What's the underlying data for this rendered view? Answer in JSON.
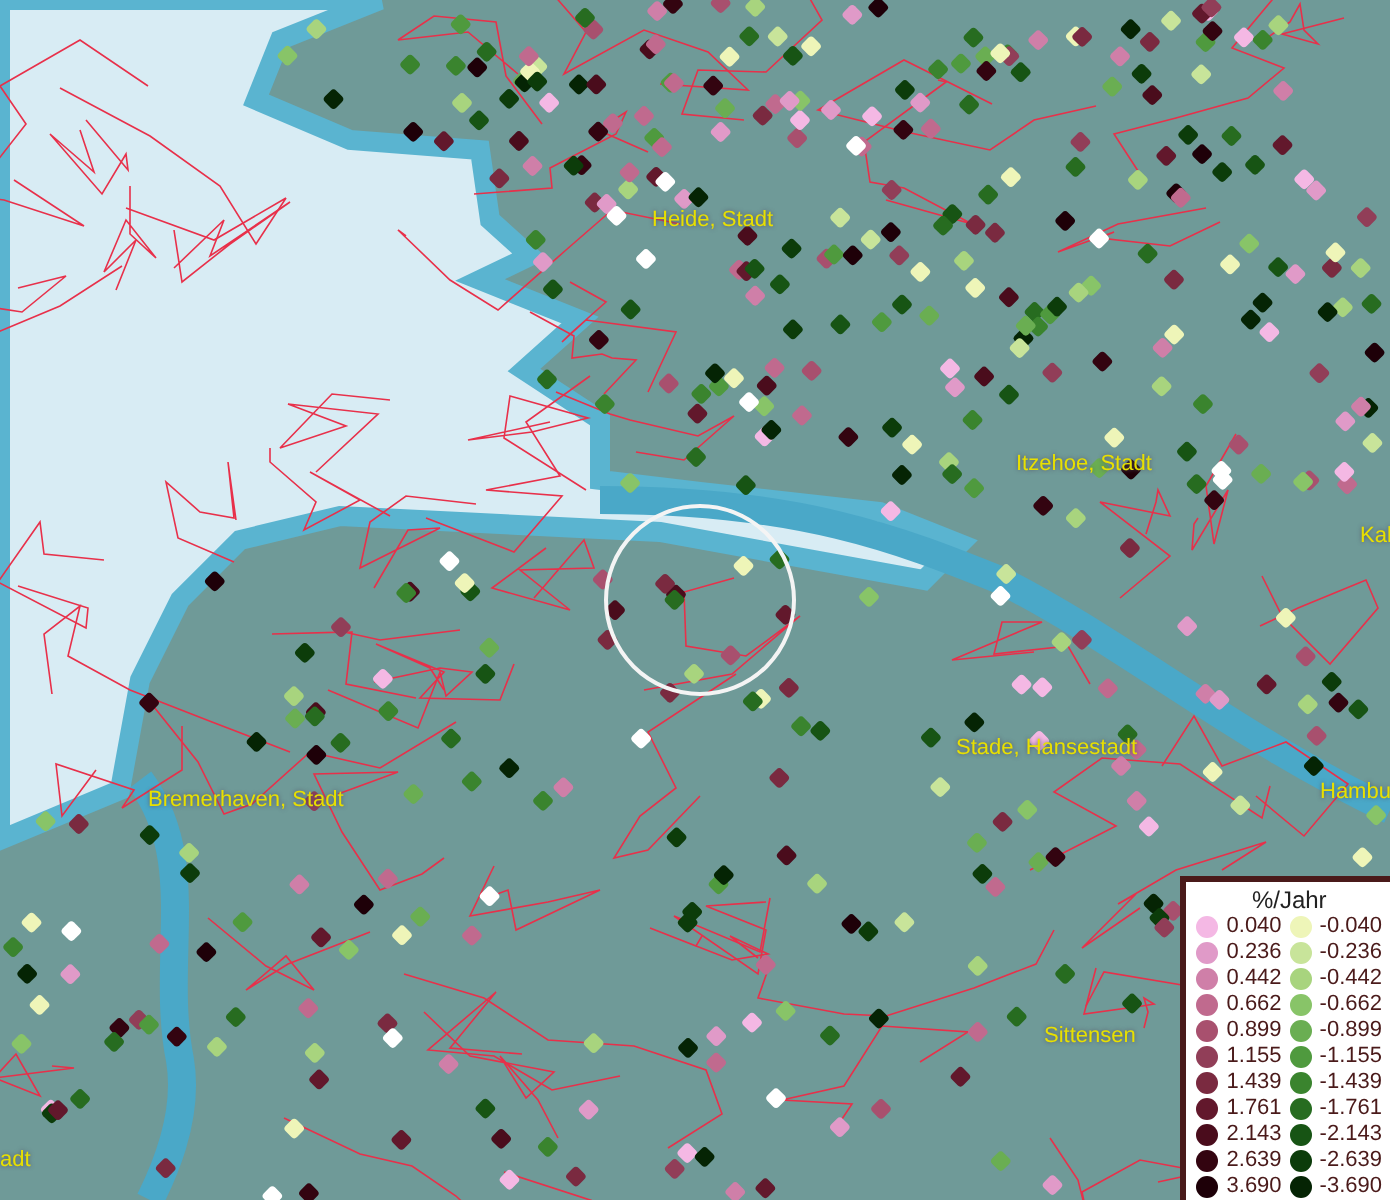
{
  "map": {
    "places": [
      {
        "name": "Heide, Stadt"
      },
      {
        "name": "Itzehoe, Stadt"
      },
      {
        "name": "Kal"
      },
      {
        "name": "Stade, Hansestadt"
      },
      {
        "name": "Hambu"
      },
      {
        "name": "Bremerhaven, Stadt"
      },
      {
        "name": "Sittensen"
      },
      {
        "name": "adt"
      }
    ]
  },
  "legend": {
    "title": "%/Jahr",
    "increase": [
      {
        "value": "0.040",
        "color": "#f4b8e4"
      },
      {
        "value": "0.236",
        "color": "#e09ac8"
      },
      {
        "value": "0.442",
        "color": "#cf7fa8"
      },
      {
        "value": "0.662",
        "color": "#c06a8e"
      },
      {
        "value": "0.899",
        "color": "#a8506e"
      },
      {
        "value": "1.155",
        "color": "#913e58"
      },
      {
        "value": "1.439",
        "color": "#7a2a40"
      },
      {
        "value": "1.761",
        "color": "#62182c"
      },
      {
        "value": "2.143",
        "color": "#4a0c1c"
      },
      {
        "value": "2.639",
        "color": "#330410"
      },
      {
        "value": "3.690",
        "color": "#1e0008"
      }
    ],
    "decrease": [
      {
        "value": "-0.040",
        "color": "#eef5b8"
      },
      {
        "value": "-0.236",
        "color": "#c8e49a"
      },
      {
        "value": "-0.442",
        "color": "#a8d47e"
      },
      {
        "value": "-0.662",
        "color": "#88c468"
      },
      {
        "value": "-0.899",
        "color": "#6aae52"
      },
      {
        "value": "-1.155",
        "color": "#4f9a3e"
      },
      {
        "value": "-1.439",
        "color": "#3a842e"
      },
      {
        "value": "-1.761",
        "color": "#276c20"
      },
      {
        "value": "-2.143",
        "color": "#175414"
      },
      {
        "value": "-2.639",
        "color": "#0c3c0a"
      },
      {
        "value": "-3.690",
        "color": "#052404"
      }
    ]
  }
}
